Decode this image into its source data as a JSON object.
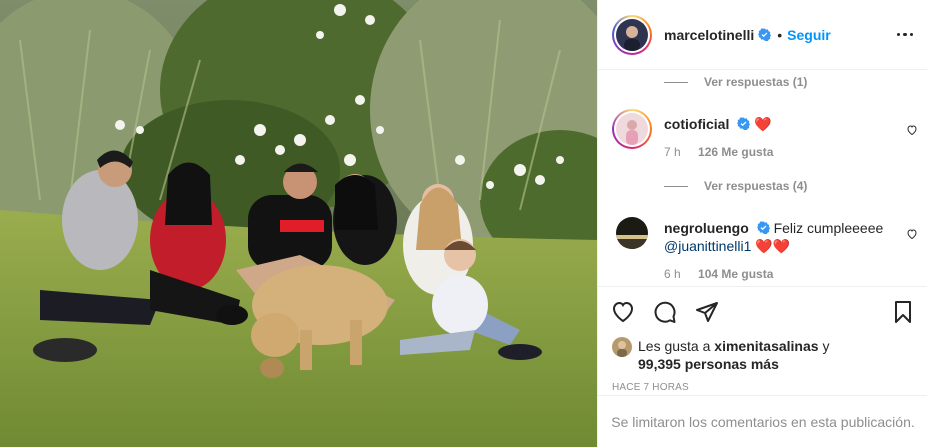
{
  "header": {
    "username": "marcelotinelli",
    "separator": "•",
    "follow_label": "Seguir"
  },
  "comments": {
    "replies_1": "Ver respuestas (1)",
    "replies_2": "Ver respuestas (4)",
    "items": [
      {
        "username": "cotioficial",
        "text": "",
        "emoji": "❤️",
        "time": "7 h",
        "likes": "126 Me gusta"
      },
      {
        "username": "negroluengo",
        "text": "Feliz cumpleeeee",
        "mention": "@juanittinelli1",
        "emoji": "❤️❤️",
        "time": "6 h",
        "likes": "104 Me gusta"
      }
    ]
  },
  "likes": {
    "prefix": "Les gusta a",
    "user": "ximenitasalinas",
    "conj": "y",
    "count": "99,395 personas más"
  },
  "timestamp": "HACE 7 HORAS",
  "restricted_notice": "Se limitaron los comentarios en esta publicación.",
  "colors": {
    "accent": "#0095f6",
    "verified": "#3897f0",
    "muted": "#8e8e8e",
    "text": "#262626"
  },
  "icons": [
    "heart-icon",
    "comment-icon",
    "share-icon",
    "bookmark-icon",
    "more-icon",
    "verified-badge-icon"
  ]
}
